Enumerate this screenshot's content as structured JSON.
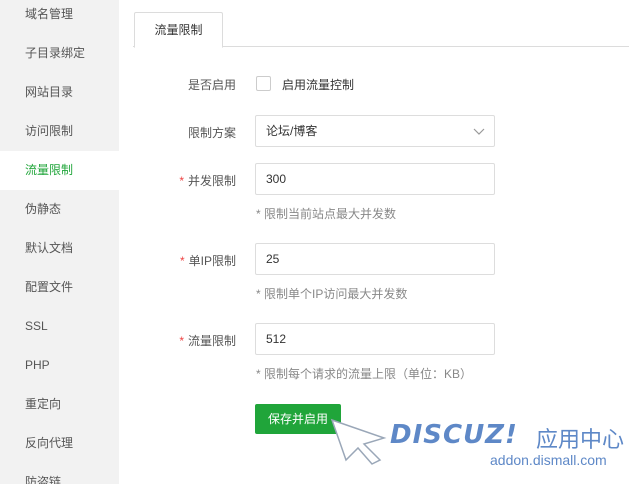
{
  "sidebar": {
    "items": [
      {
        "label": "域名管理"
      },
      {
        "label": "子目录绑定"
      },
      {
        "label": "网站目录"
      },
      {
        "label": "访问限制"
      },
      {
        "label": "流量限制",
        "active": true
      },
      {
        "label": "伪静态"
      },
      {
        "label": "默认文档"
      },
      {
        "label": "配置文件"
      },
      {
        "label": "SSL"
      },
      {
        "label": "PHP"
      },
      {
        "label": "重定向"
      },
      {
        "label": "反向代理"
      },
      {
        "label": "防盗链"
      }
    ]
  },
  "tabs": [
    {
      "label": "流量限制"
    }
  ],
  "form": {
    "enable": {
      "label": "是否启用",
      "checkbox_label": "启用流量控制",
      "checked": false
    },
    "scheme": {
      "label": "限制方案",
      "selected": "论坛/博客"
    },
    "concurrent": {
      "required_mark": "*",
      "label": "并发限制",
      "value": "300",
      "hint": "* 限制当前站点最大并发数"
    },
    "per_ip": {
      "required_mark": "*",
      "label": "单IP限制",
      "value": "25",
      "hint": "* 限制单个IP访问最大并发数"
    },
    "traffic": {
      "required_mark": "*",
      "label": "流量限制",
      "value": "512",
      "hint": "* 限制每个请求的流量上限（单位：KB）"
    },
    "save_label": "保存并启用"
  },
  "watermark": {
    "brand": "DISCUZ!",
    "brand_cn": "应用中心",
    "url": "addon.dismall.com"
  },
  "colors": {
    "accent": "#20a53a",
    "required": "#ee4444",
    "watermark": "#5e88c7"
  }
}
